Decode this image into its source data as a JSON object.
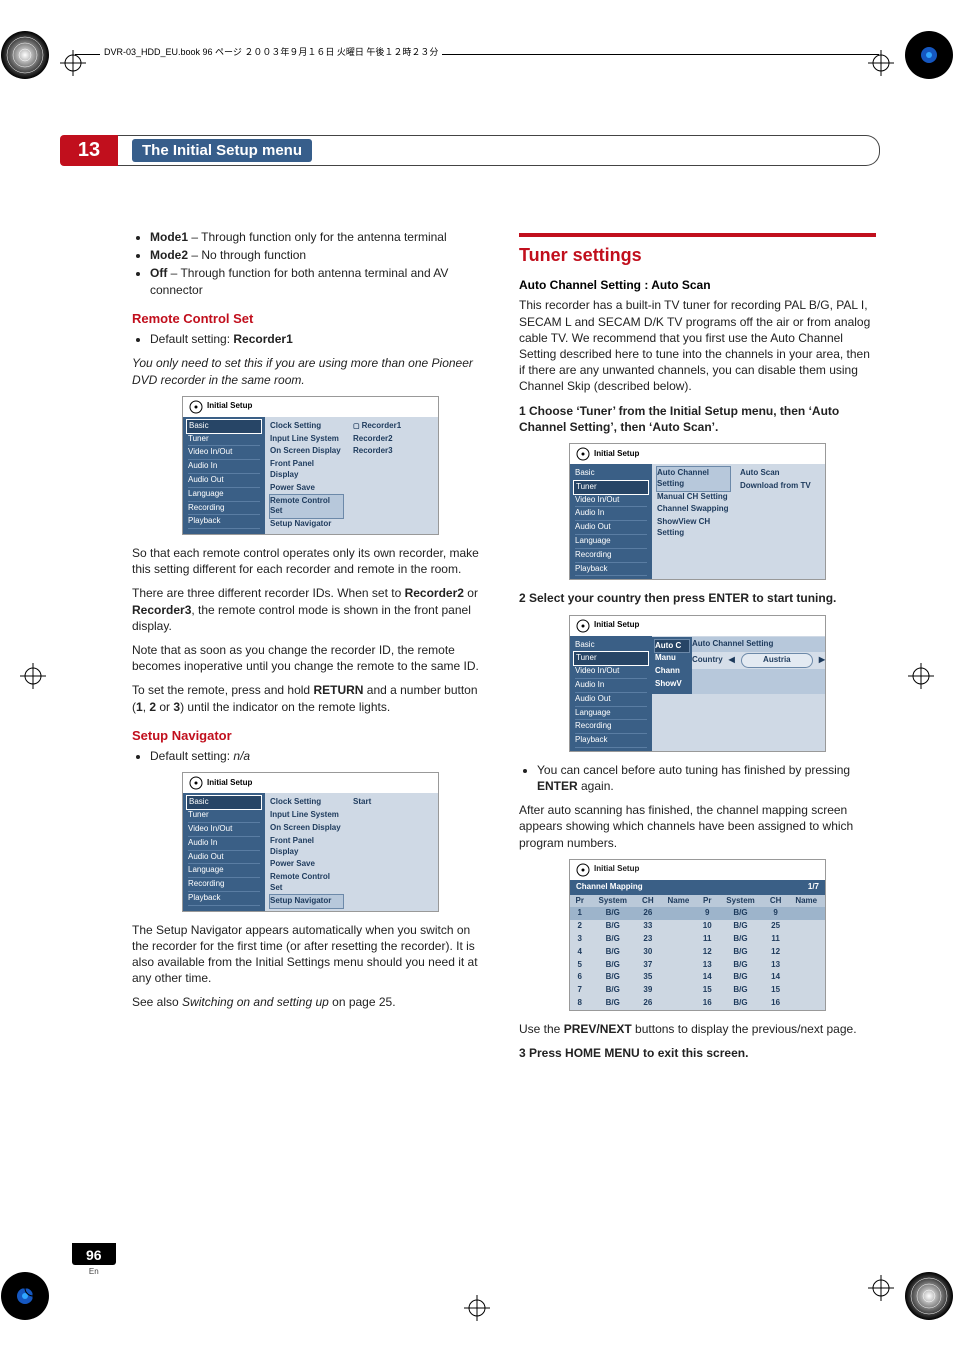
{
  "file_header": "DVR-03_HDD_EU.book 96 ページ ２００３年９月１６日 火曜日 午後１２時２３分",
  "chapter": {
    "num": "13",
    "title": "The Initial Setup menu"
  },
  "left": {
    "modes": [
      {
        "name": "Mode1",
        "desc": " – Through function only for the antenna terminal"
      },
      {
        "name": "Mode2",
        "desc": " – No through function"
      },
      {
        "name": "Off",
        "desc": " – Through function for both antenna terminal and AV connector"
      }
    ],
    "rcs_heading": "Remote Control Set",
    "rcs_default_lead": "Default setting: ",
    "rcs_default_val": "Recorder1",
    "rcs_note": "You only need to set this if you are using more than one Pioneer DVD recorder in the same room.",
    "rcs_para1": "So that each remote control operates only its own recorder, make this setting different for each recorder and remote in the room.",
    "rcs_para2a": "There are three different recorder IDs. When set to ",
    "rcs_para2b": "Recorder2",
    "rcs_para2c": " or ",
    "rcs_para2d": "Recorder3",
    "rcs_para2e": ", the remote control mode is shown in the front panel display.",
    "rcs_para3": "Note that as soon as you change the recorder ID, the remote becomes inoperative until you change the remote to the same ID.",
    "rcs_para4a": "To set the remote, press and hold ",
    "rcs_para4b": "RETURN",
    "rcs_para4c": " and a number button (",
    "rcs_para4d": "1",
    "rcs_para4e": ", ",
    "rcs_para4f": "2",
    "rcs_para4g": " or ",
    "rcs_para4h": "3",
    "rcs_para4i": ") until the indicator on the remote lights.",
    "sn_heading": "Setup Navigator",
    "sn_default_lead": "Default setting: ",
    "sn_default_val": "n/a",
    "sn_para1": "The Setup Navigator appears automatically when you switch on the recorder for the first time (or after resetting the recorder). It is also available from the Initial Settings menu should you need it at any other time.",
    "sn_para2a": "See also ",
    "sn_para2b": "Switching on and setting up",
    "sn_para2c": " on page 25.",
    "shot_common": {
      "title": "Initial Setup",
      "left_items": [
        "Basic",
        "Tuner",
        "Video In/Out",
        "Audio In",
        "Audio Out",
        "Language",
        "Recording",
        "Playback"
      ]
    },
    "shot1_mid": [
      "Clock Setting",
      "Input Line System",
      "On Screen Display",
      "Front Panel Display",
      "Power Save",
      "Remote Control Set",
      "Setup Navigator"
    ],
    "shot1_right": [
      "Recorder1",
      "Recorder2",
      "Recorder3"
    ],
    "shot2_mid": [
      "Clock Setting",
      "Input Line System",
      "On Screen Display",
      "Front Panel Display",
      "Power Save",
      "Remote Control Set",
      "Setup Navigator"
    ],
    "shot2_right": [
      "Start"
    ]
  },
  "right": {
    "h2": "Tuner settings",
    "h4a": "Auto Channel Setting : Auto Scan",
    "p1": "This recorder has a built-in TV tuner for recording PAL B/G, PAL I, SECAM L and SECAM D/K TV programs off the air or from analog cable TV. We recommend that you first use the Auto Channel Setting described here to tune into the channels in your area, then if there are any unwanted channels, you can disable them using Channel Skip (described below).",
    "step1": "1    Choose ‘Tuner’ from the Initial Setup menu, then ‘Auto Channel Setting’, then ‘Auto Scan’.",
    "shot3_mid": [
      "Auto Channel Setting",
      "Manual CH Setting",
      "Channel Swapping",
      "ShowView CH Setting"
    ],
    "shot3_right": [
      "Auto Scan",
      "Download from TV"
    ],
    "step2": "2    Select your country then press ENTER to start tuning.",
    "shot4_submenu_label": "Auto Channel Setting",
    "shot4_midcol": [
      "Auto C",
      "Manu",
      "Chann",
      "ShowV"
    ],
    "shot4_country_label": "Country",
    "shot4_country_value": "Austria",
    "bullet_a": "You can cancel before auto tuning has finished by pressing ",
    "bullet_b": "ENTER",
    "bullet_c": " again.",
    "p2": "After auto scanning has finished, the channel mapping screen appears showing which channels have been assigned to which program numbers.",
    "map_title": "Channel Mapping",
    "map_page": "1/7",
    "map_headers": [
      "Pr",
      "System",
      "CH",
      "Name",
      "Pr",
      "System",
      "CH",
      "Name"
    ],
    "p3a": "Use the ",
    "p3b": "PREV/NEXT",
    "p3c": " buttons to display the previous/next page.",
    "step3": "3    Press HOME MENU to exit this screen."
  },
  "chart_data": {
    "type": "table",
    "title": "Channel Mapping 1/7",
    "columns": [
      "Pr",
      "System",
      "CH",
      "Name"
    ],
    "rows_left": [
      {
        "Pr": 1,
        "System": "B/G",
        "CH": 26,
        "Name": ""
      },
      {
        "Pr": 2,
        "System": "B/G",
        "CH": 33,
        "Name": ""
      },
      {
        "Pr": 3,
        "System": "B/G",
        "CH": 23,
        "Name": ""
      },
      {
        "Pr": 4,
        "System": "B/G",
        "CH": 30,
        "Name": ""
      },
      {
        "Pr": 5,
        "System": "B/G",
        "CH": 37,
        "Name": ""
      },
      {
        "Pr": 6,
        "System": "B/G",
        "CH": 35,
        "Name": ""
      },
      {
        "Pr": 7,
        "System": "B/G",
        "CH": 39,
        "Name": ""
      },
      {
        "Pr": 8,
        "System": "B/G",
        "CH": 26,
        "Name": ""
      }
    ],
    "rows_right": [
      {
        "Pr": 9,
        "System": "B/G",
        "CH": 9,
        "Name": ""
      },
      {
        "Pr": 10,
        "System": "B/G",
        "CH": 25,
        "Name": ""
      },
      {
        "Pr": 11,
        "System": "B/G",
        "CH": 11,
        "Name": ""
      },
      {
        "Pr": 12,
        "System": "B/G",
        "CH": 12,
        "Name": ""
      },
      {
        "Pr": 13,
        "System": "B/G",
        "CH": 13,
        "Name": ""
      },
      {
        "Pr": 14,
        "System": "B/G",
        "CH": 14,
        "Name": ""
      },
      {
        "Pr": 15,
        "System": "B/G",
        "CH": 15,
        "Name": ""
      },
      {
        "Pr": 16,
        "System": "B/G",
        "CH": 16,
        "Name": ""
      }
    ]
  },
  "footer": {
    "page": "96",
    "lang": "En"
  }
}
